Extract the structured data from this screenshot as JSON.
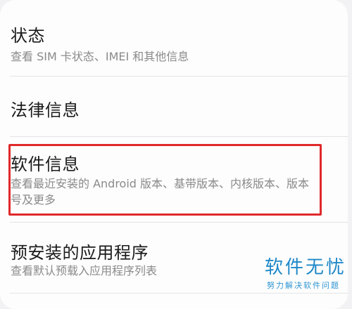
{
  "settings": {
    "items": [
      {
        "title": "状态",
        "subtitle": "查看 SIM 卡状态、IMEI 和其他信息"
      },
      {
        "title": "法律信息",
        "subtitle": ""
      },
      {
        "title": "软件信息",
        "subtitle": "查看最近安装的 Android 版本、基带版本、内核版本、版本号及更多"
      },
      {
        "title": "预安装的应用程序",
        "subtitle": "查看默认预载入应用程序列表"
      }
    ]
  },
  "watermark": {
    "text": "软件无忧",
    "subtext": "努力解决软件问题"
  },
  "colors": {
    "highlight": "#e0282a",
    "watermark": "#1e88c8"
  }
}
